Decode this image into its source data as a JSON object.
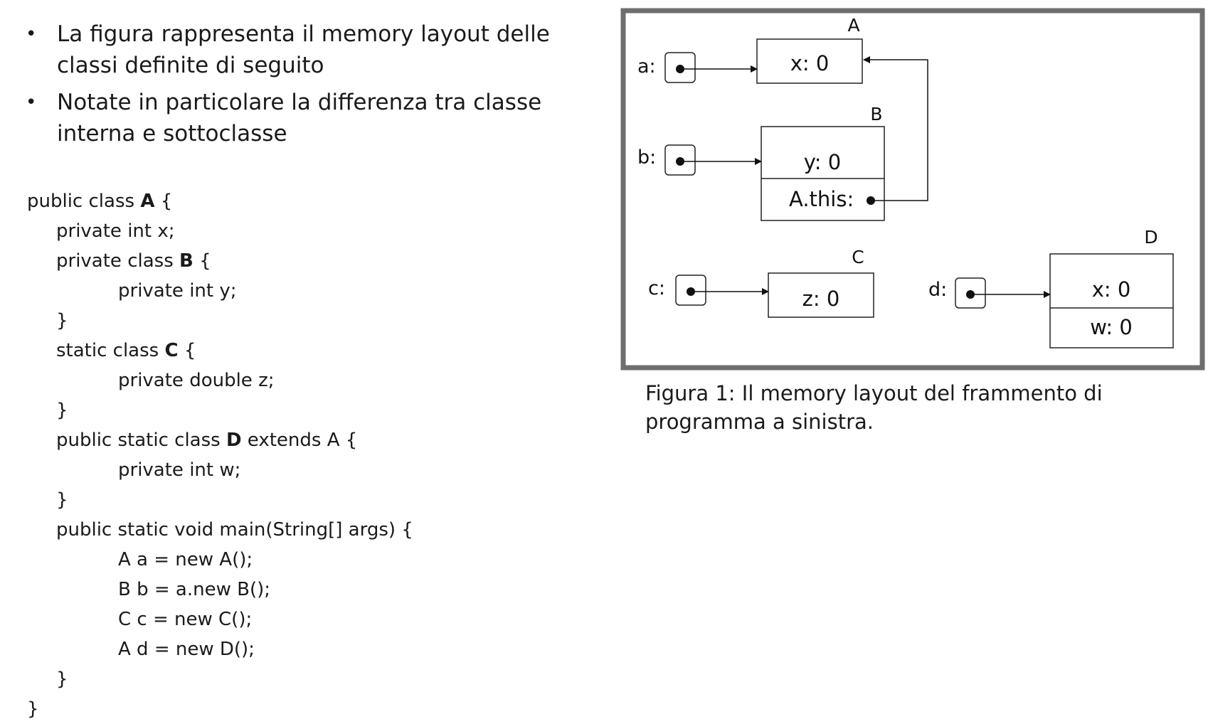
{
  "bullets": [
    "La figura rappresenta il memory layout delle classi definite di seguito",
    "Notate in particolare la differenza tra classe interna e sottoclasse"
  ],
  "bullet_symbol": "•",
  "code": {
    "l1_pre": "public class ",
    "l1_name": "A",
    "l1_post": " {",
    "l2": "private int x;",
    "l3_pre": "private class ",
    "l3_name": "B",
    "l3_post": " {",
    "l4": "private int y;",
    "l5": "}",
    "l6_pre": "static class ",
    "l6_name": "C",
    "l6_post": " {",
    "l7": "private double z;",
    "l8": "}",
    "l9_pre": "public static class ",
    "l9_name": "D",
    "l9_post": " extends A {",
    "l10": "private int w;",
    "l11": "}",
    "l12": "public static void main(String[] args) {",
    "l13": "A a = new A();",
    "l14": "B b = a.new B();",
    "l15": "C c = new C();",
    "l16": "A d = new D();",
    "l17": "}",
    "l18": "}"
  },
  "diagram": {
    "vars": {
      "a": "a:",
      "b": "b:",
      "c": "c:",
      "d": "d:"
    },
    "objects": {
      "A": {
        "title": "A",
        "fields": [
          "x: 0"
        ]
      },
      "B": {
        "title": "B",
        "fields": [
          "y: 0",
          "A.this:"
        ]
      },
      "C": {
        "title": "C",
        "fields": [
          "z: 0"
        ]
      },
      "D": {
        "title": "D",
        "fields": [
          "x: 0",
          "w: 0"
        ]
      }
    },
    "colors": {
      "frame": "#6e6e6e",
      "line": "#111111"
    }
  },
  "caption": "Figura 1: Il memory layout del frammento di programma a sinistra."
}
